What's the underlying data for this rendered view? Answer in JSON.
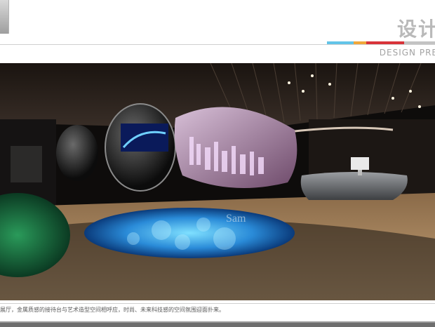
{
  "header": {
    "title": "设计",
    "subtitle": "DESIGN PRE",
    "accent_colors": [
      "#62c4e8",
      "#f0a73a",
      "#d8343a",
      "#c3c3c3"
    ]
  },
  "render": {
    "watermark": "Sam",
    "image_subject": "exhibition hall interior rendering"
  },
  "caption": {
    "text": "展厅，金属质感的接待台与艺术造型空间相呼应，时尚、未来科技感的空间氛围迎面扑来。"
  }
}
